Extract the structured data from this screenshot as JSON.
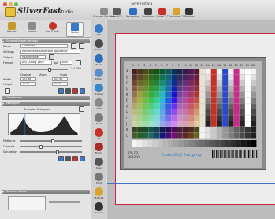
{
  "window": {
    "title": "SilverFast 8.8",
    "app_name": "SilverFast",
    "app_subtitle": "Ai Studio"
  },
  "toolbar": {
    "buttons": [
      {
        "label": "Scanner Set Press",
        "icon": "scanner-icon",
        "color": "#8a8a8a"
      },
      {
        "label": "Auto-ACR",
        "icon": "auto-icon",
        "color": "#5a5a5a"
      },
      {
        "label": "Navigation",
        "icon": "navigation-icon",
        "color": "#2a6fc0"
      },
      {
        "label": "Gradation",
        "icon": "gradation-icon",
        "color": "#444444"
      },
      {
        "label": "Global CC",
        "icon": "global-cc-icon",
        "color": "#c8302a"
      },
      {
        "label": "Selective CC",
        "icon": "selective-cc-icon",
        "color": "#d9a22a"
      },
      {
        "label": "Batches",
        "icon": "batch-icon",
        "color": "#333333"
      }
    ]
  },
  "panel": {
    "tabs": [
      {
        "label": "Presets",
        "icon": "presets-icon",
        "color": "#c49a2a"
      },
      {
        "label": "Frames",
        "icon": "frames-icon",
        "color": "#8a8a8a"
      },
      {
        "label": "Inf. & Info",
        "icon": "info-icon",
        "color": "#c8302a"
      },
      {
        "label": "Notes",
        "icon": "notes-icon",
        "color": "#3a7ac9"
      }
    ],
    "section_general": "General Image Settings",
    "name_label": "Name",
    "name_value": "Landscape",
    "settings_label": "Settings",
    "settings_value": "Monochrome Landscape Application",
    "output_label": "Output",
    "output_value": "Monochrome",
    "format_label": "Format",
    "format_value": "Any Quality 1600",
    "dpi_label": "dpi",
    "dpi_value": "3000",
    "ratio_value": "1:1.000",
    "original_label": "Original",
    "zoom_label": "Zoom",
    "scale_label": "Scale",
    "width_label": "Width",
    "height_label": "Height",
    "width_original": "103.96",
    "height_original": "75.00",
    "width_scaled": "103.96",
    "height_scaled": "75.00",
    "section_dimensions": "Dimensions",
    "section_histogram": "Histogram",
    "histogram_label": "Scanpilot Histogram",
    "midtones_label": "Midtones",
    "contrast_label": "Contrast",
    "saturation_label": "Saturation",
    "section_scanner": "Scanner Status",
    "midtones_level": 0.52,
    "contrast_level": 0.31,
    "saturation_level": 0.6
  },
  "tools": [
    {
      "label": "Info",
      "icon": "info-tool-icon",
      "color": "#3a7ac9"
    },
    {
      "label": "Select",
      "icon": "select-tool-icon",
      "color": "#4a4a4a"
    },
    {
      "label": "Zoom",
      "icon": "zoom-tool-icon",
      "color": "#2a6fc0"
    },
    {
      "label": "Picker",
      "icon": "picker-tool-icon",
      "color": "#5a8ec9"
    },
    {
      "label": "Preview",
      "icon": "preview-tool-icon",
      "color": "#3a88c9"
    },
    {
      "label": "USM",
      "icon": "usm-tool-icon",
      "color": "#888888"
    },
    {
      "label": "Dust",
      "icon": "dust-tool-icon",
      "color": "#7a7a7a"
    },
    {
      "label": "IR",
      "icon": "ir-tool-icon",
      "color": "#c8302a"
    },
    {
      "label": "Frame",
      "icon": "frame-tool-icon",
      "color": "#aa2a2a"
    },
    {
      "label": "Scan",
      "icon": "scan-tool-icon",
      "color": "#555555"
    },
    {
      "label": "Print",
      "icon": "print-tool-icon",
      "color": "#777777"
    },
    {
      "label": "Multi-Ex",
      "icon": "multi-ex-tool-icon",
      "color": "#d9a22a"
    },
    {
      "label": "Preview",
      "icon": "preview2-tool-icon",
      "color": "#333333"
    }
  ],
  "target": {
    "row_letters": [
      "A",
      "B",
      "C",
      "D",
      "E",
      "F",
      "G",
      "H",
      "I",
      "J",
      "K",
      "L"
    ],
    "column_numbers": [
      "1",
      "2",
      "3",
      "4",
      "5",
      "6",
      "7",
      "8",
      "9",
      "10",
      "11",
      "12",
      "13",
      "14",
      "15",
      "16",
      "17",
      "18",
      "19",
      "20",
      "21",
      "22"
    ],
    "brand_text": "LaserSoft Imaging",
    "code_text": "IT8.7/2",
    "version_text": "2012 V2"
  },
  "colors": {
    "accent": "#3b74c9",
    "frame_red": "#c22244"
  }
}
